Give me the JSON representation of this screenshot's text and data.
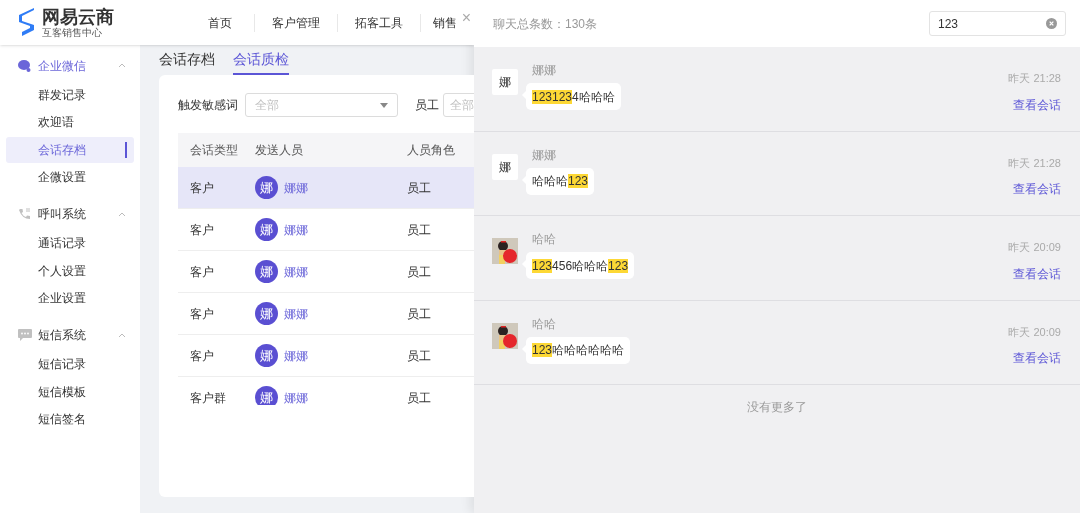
{
  "logo": {
    "name": "网易云商",
    "tagline": "互客销售中心"
  },
  "nav": [
    {
      "label": "首页"
    },
    {
      "label": "客户管理"
    },
    {
      "label": "拓客工具"
    },
    {
      "label": "销售"
    }
  ],
  "sidebar": {
    "groups": [
      {
        "label": "企业微信",
        "kind": "chat",
        "active": true,
        "expanded": true,
        "children": [
          {
            "label": "群发记录",
            "selected": false
          },
          {
            "label": "欢迎语",
            "selected": false
          },
          {
            "label": "会话存档",
            "selected": true
          },
          {
            "label": "企微设置",
            "selected": false
          }
        ]
      },
      {
        "label": "呼叫系统",
        "kind": "phone",
        "active": false,
        "expanded": true,
        "children": [
          {
            "label": "通话记录",
            "selected": false
          },
          {
            "label": "个人设置",
            "selected": false
          },
          {
            "label": "企业设置",
            "selected": false
          }
        ]
      },
      {
        "label": "短信系统",
        "kind": "sms",
        "active": false,
        "expanded": true,
        "children": [
          {
            "label": "短信记录",
            "selected": false
          },
          {
            "label": "短信模板",
            "selected": false
          },
          {
            "label": "短信签名",
            "selected": false
          }
        ]
      }
    ]
  },
  "tabs": [
    {
      "label": "会话存档",
      "selected": false
    },
    {
      "label": "会话质检",
      "selected": true
    }
  ],
  "filters": [
    {
      "label": "触发敏感词",
      "placeholder": "全部"
    },
    {
      "label": "员工",
      "placeholder": "全部"
    }
  ],
  "table": {
    "columns": [
      "会话类型",
      "发送人员",
      "人员角色"
    ],
    "rows": [
      {
        "type": "客户",
        "avatar": "娜",
        "sender": "娜娜",
        "role": "员工",
        "selected": true
      },
      {
        "type": "客户",
        "avatar": "娜",
        "sender": "娜娜",
        "role": "员工",
        "selected": false
      },
      {
        "type": "客户",
        "avatar": "娜",
        "sender": "娜娜",
        "role": "员工",
        "selected": false
      },
      {
        "type": "客户",
        "avatar": "娜",
        "sender": "娜娜",
        "role": "员工",
        "selected": false
      },
      {
        "type": "客户",
        "avatar": "娜",
        "sender": "娜娜",
        "role": "员工",
        "selected": false
      },
      {
        "type": "客户群",
        "avatar": "娜",
        "sender": "娜娜",
        "role": "员工",
        "selected": false
      }
    ]
  },
  "drawer": {
    "close": "×",
    "total": "聊天总条数：130条",
    "search": {
      "value": "123"
    },
    "messages": [
      {
        "sender": "娜娜",
        "kind": "initial",
        "avatar": "娜",
        "time": "昨天 21:28",
        "link": "查看会话",
        "segments": [
          {
            "text": "123123",
            "highlight": true
          },
          {
            "text": "4哈哈哈",
            "highlight": false
          }
        ]
      },
      {
        "sender": "娜娜",
        "kind": "initial",
        "avatar": "娜",
        "time": "昨天 21:28",
        "link": "查看会话",
        "segments": [
          {
            "text": "哈哈哈",
            "highlight": false
          },
          {
            "text": "123",
            "highlight": true
          }
        ]
      },
      {
        "sender": "哈哈",
        "kind": "picture",
        "time": "昨天 20:09",
        "link": "查看会话",
        "segments": [
          {
            "text": "123",
            "highlight": true
          },
          {
            "text": "456哈哈哈",
            "highlight": false
          },
          {
            "text": "123",
            "highlight": true
          }
        ]
      },
      {
        "sender": "哈哈",
        "kind": "picture",
        "time": "昨天 20:09",
        "link": "查看会话",
        "segments": [
          {
            "text": "123",
            "highlight": true
          },
          {
            "text": "哈哈哈哈哈哈",
            "highlight": false
          }
        ]
      }
    ],
    "footer": "没有更多了"
  }
}
